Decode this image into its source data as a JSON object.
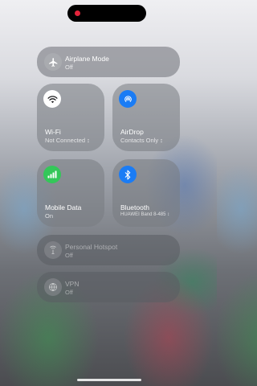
{
  "controls": {
    "airplane": {
      "label": "Airplane Mode",
      "status": "Off"
    },
    "wifi": {
      "label": "Wi-Fi",
      "status": "Not Connected ↕"
    },
    "airdrop": {
      "label": "AirDrop",
      "status": "Contacts Only ↕"
    },
    "mobile_data": {
      "label": "Mobile Data",
      "status": "On"
    },
    "bluetooth": {
      "label": "Bluetooth",
      "status": "HUAWEI Band 8-485 ↕"
    },
    "hotspot": {
      "label": "Personal Hotspot",
      "status": "Off"
    },
    "vpn": {
      "label": "VPN",
      "status": "Off"
    }
  },
  "colors": {
    "wifi_on": "#ffffff",
    "airdrop_accent": "#1a7cf5",
    "mobile_data_accent": "#34c759",
    "bluetooth_accent": "#1a7cf5",
    "recording_dot": "#e3243b"
  },
  "icons": {
    "airplane": "airplane-icon",
    "wifi": "wifi-icon",
    "airdrop": "airdrop-icon",
    "mobile_data": "cellular-icon",
    "bluetooth": "bluetooth-icon",
    "hotspot": "hotspot-icon",
    "vpn": "vpn-icon"
  }
}
